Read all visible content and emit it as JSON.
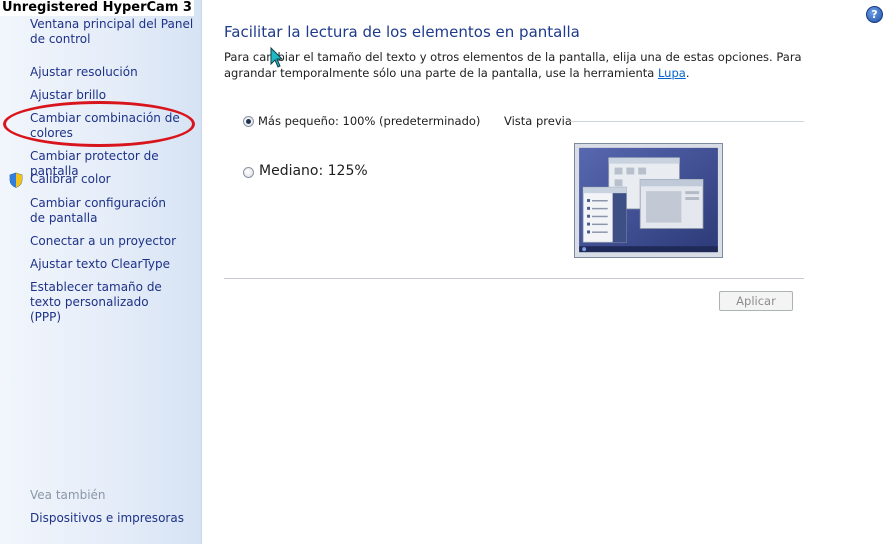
{
  "watermark": "Unregistered HyperCam 3",
  "sidebar": {
    "items": [
      {
        "label": "Ventana principal del Panel de control"
      },
      {
        "label": "Ajustar resolución"
      },
      {
        "label": "Ajustar brillo"
      },
      {
        "label": "Cambiar combinación de colores"
      },
      {
        "label": "Cambiar protector de pantalla"
      },
      {
        "label": "Calibrar color",
        "icon": "shield-icon"
      },
      {
        "label": "Cambiar configuración de pantalla"
      },
      {
        "label": "Conectar a un proyector"
      },
      {
        "label": "Ajustar texto ClearType"
      },
      {
        "label": "Establecer tamaño de texto personalizado (PPP)"
      }
    ],
    "see_also": "Vea también",
    "see_also_items": [
      {
        "label": "Dispositivos e impresoras"
      }
    ]
  },
  "main": {
    "title": "Facilitar la lectura de los elementos en pantalla",
    "description_before": "Para cambiar el tamaño del texto y otros elementos de la pantalla, elija una de estas opciones. Para agrandar temporalmente sólo una parte de la pantalla, use la herramienta ",
    "description_link": "Lupa",
    "description_after": ".",
    "options": [
      {
        "label": "Más pequeño: 100% (predeterminado)",
        "selected": true
      },
      {
        "label": "Mediano: 125%",
        "selected": false
      }
    ],
    "preview_label": "Vista previa",
    "apply_label": "Aplicar",
    "help_icon_text": "?"
  },
  "colors": {
    "link": "#1e3287",
    "title": "#1e3a8a",
    "highlight_ellipse": "#d8141c"
  }
}
